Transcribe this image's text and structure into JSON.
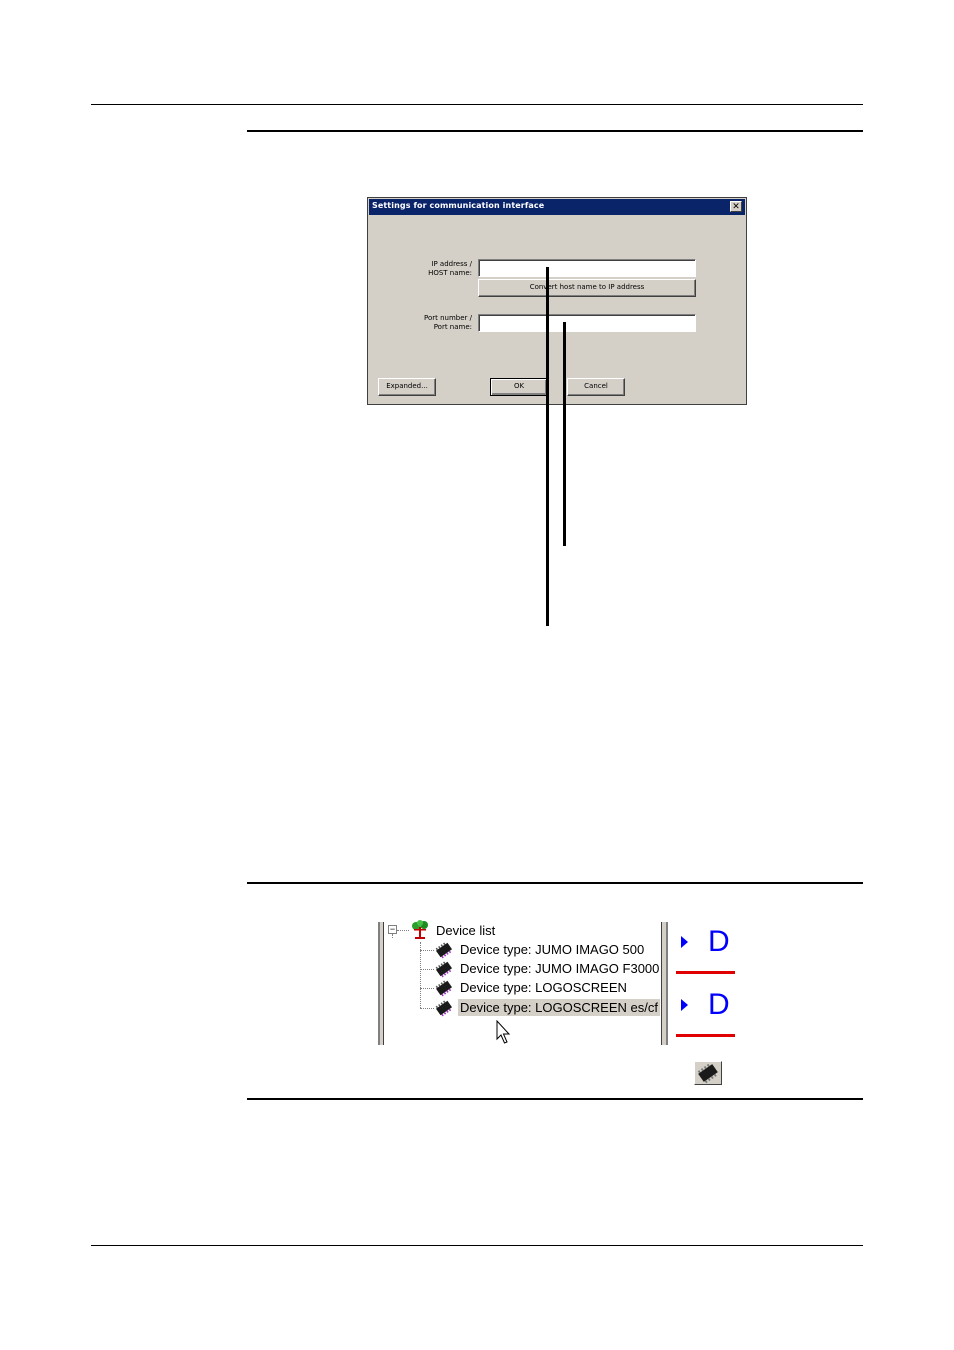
{
  "dialog": {
    "title": "Settings for communication interface",
    "close_glyph": "✕",
    "ip_label": "IP address /\nHOST name:",
    "ip_value": "",
    "convert_label": "Convert host name to IP address",
    "port_label": "Port number /\nPort name:",
    "port_value": "",
    "expanded_label": "Expanded...",
    "ok_label": "OK",
    "cancel_label": "Cancel"
  },
  "device_tree": {
    "expander": "−",
    "root_label": "Device list",
    "items": [
      {
        "label": "Device type: JUMO IMAGO 500",
        "selected": false,
        "icon": "device-chip-icon"
      },
      {
        "label": "Device type: JUMO IMAGO F3000",
        "selected": false,
        "icon": "device-chip-icon"
      },
      {
        "label": "Device type: LOGOSCREEN",
        "selected": false,
        "icon": "device-chip-icon"
      },
      {
        "label": "Device type: LOGOSCREEN es/cf",
        "selected": true,
        "icon": "device-chip-icon"
      }
    ]
  },
  "side_panel": {
    "marker_1": "D",
    "marker_2": "D"
  },
  "toolbar": {
    "icon": "device-chip-icon"
  },
  "colors": {
    "titlebar": "#0a246a",
    "dialog_face": "#d4d0c8",
    "marker_blue": "#0000ff",
    "marker_red": "#e00000"
  }
}
